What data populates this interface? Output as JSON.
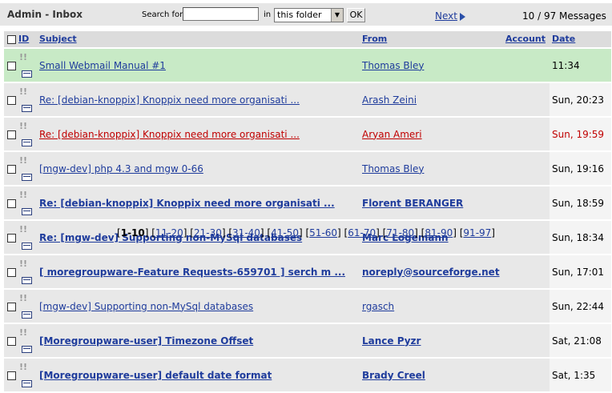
{
  "header": {
    "title": "Admin - Inbox",
    "search_label": "Search for",
    "search_value": "",
    "in_label": "in",
    "folder_selected": "this folder",
    "ok_label": "OK",
    "next_label": "Next",
    "message_count": "10 / 97 Messages"
  },
  "columns": {
    "id": "ID",
    "subject": "Subject",
    "from": "From",
    "account": "Account",
    "date": "Date"
  },
  "messages": [
    {
      "subject": "Small Webmail Manual #1",
      "from": "Thomas Bley",
      "date": "11:34",
      "style": "green"
    },
    {
      "subject": "Re: [debian-knoppix] Knoppix need more organisati ...",
      "from": "Arash Zeini",
      "date": "Sun, 20:23",
      "style": "normal"
    },
    {
      "subject": "Re: [debian-knoppix] Knoppix need more organisati ...",
      "from": "Aryan Ameri",
      "date": "Sun, 19:59",
      "style": "red"
    },
    {
      "subject": "[mgw-dev] php 4.3 and mgw 0-66",
      "from": "Thomas Bley",
      "date": "Sun, 19:16",
      "style": "normal"
    },
    {
      "subject": "Re: [debian-knoppix] Knoppix need more organisati ...",
      "from": "Florent BERANGER",
      "date": "Sun, 18:59",
      "style": "bold"
    },
    {
      "subject": "Re: [mgw-dev] Supporting non-MySql databases",
      "from": "Marc Logemann",
      "date": "Sun, 18:34",
      "style": "bold"
    },
    {
      "subject": "[ moregroupware-Feature Requests-659701 ] serch m ...",
      "from": "noreply@sourceforge.net",
      "date": "Sun, 17:01",
      "style": "bold"
    },
    {
      "subject": "[mgw-dev] Supporting non-MySql databases",
      "from": "rgasch",
      "date": "Sun, 22:44",
      "style": "normal"
    },
    {
      "subject": "[Moregroupware-user] Timezone Offset",
      "from": "Lance Pyzr",
      "date": "Sat, 21:08",
      "style": "bold"
    },
    {
      "subject": "[Moregroupware-user] default date format",
      "from": "Brady Creel",
      "date": "Sat, 1:35",
      "style": "bold"
    }
  ],
  "pager": {
    "current": "1-10",
    "pages": [
      "11-20",
      "21-30",
      "31-40",
      "41-50",
      "51-60",
      "61-70",
      "71-80",
      "81-90",
      "91-97"
    ]
  }
}
